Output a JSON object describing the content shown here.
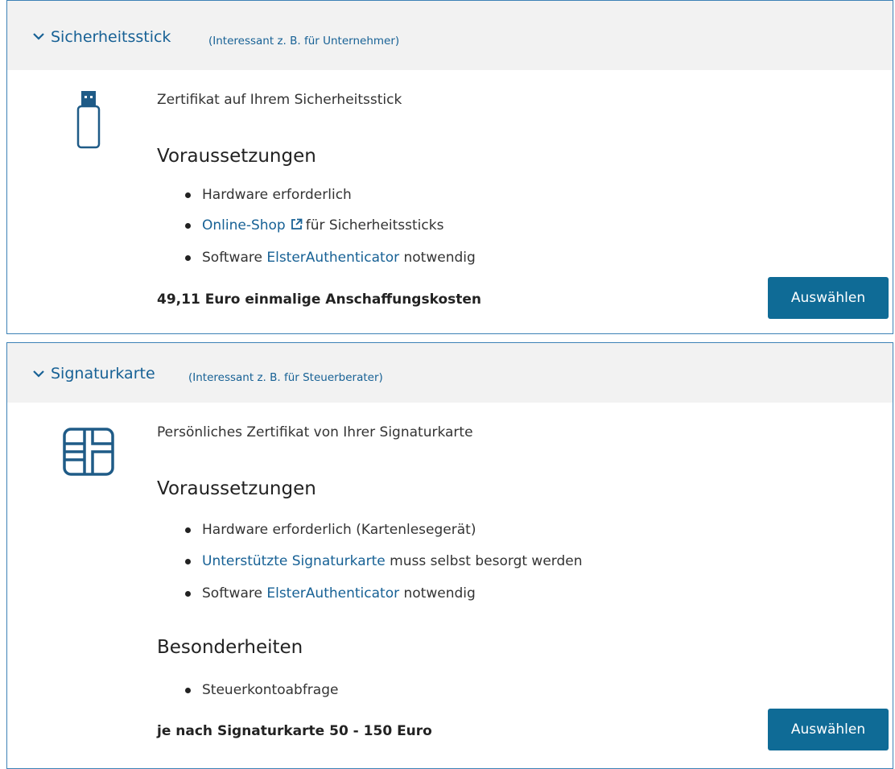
{
  "options": [
    {
      "title": "Sicherheitsstick",
      "subtitle": "(Interessant z. B. für Unternehmer)",
      "icon": "usb-stick-icon",
      "description": "Zertifikat auf Ihrem Sicherheitsstick",
      "requirements_heading": "Voraussetzungen",
      "requirements": [
        {
          "text": "Hardware erforderlich"
        },
        {
          "link": "Online-Shop",
          "external_icon": "external-link-icon",
          "text_after": "für Sicherheitssticks"
        },
        {
          "text_before": "Software",
          "link": "ElsterAuthenticator",
          "text_after": "notwendig"
        }
      ],
      "price": "49,11 Euro einmalige Anschaffungskosten",
      "button_label": "Auswählen"
    },
    {
      "title": "Signaturkarte",
      "subtitle": "(Interessant z. B. für Steuerberater)",
      "icon": "chip-card-icon",
      "description": "Persönliches Zertifikat von Ihrer Signaturkarte",
      "requirements_heading": "Voraussetzungen",
      "requirements": [
        {
          "text": "Hardware erforderlich (Kartenlesegerät)"
        },
        {
          "link": "Unterstützte Signaturkarte",
          "text_after": "muss selbst besorgt werden"
        },
        {
          "text_before": "Software",
          "link": "ElsterAuthenticator",
          "text_after": "notwendig"
        }
      ],
      "features_heading": "Besonderheiten",
      "features": [
        {
          "text": "Steuerkontoabfrage"
        }
      ],
      "price": "je nach Signaturkarte 50 - 150 Euro",
      "button_label": "Auswählen"
    }
  ],
  "colors": {
    "accent": "#176195",
    "button_bg": "#0f6b96",
    "border": "#3d82b6",
    "header_bg": "#f2f2f2"
  }
}
